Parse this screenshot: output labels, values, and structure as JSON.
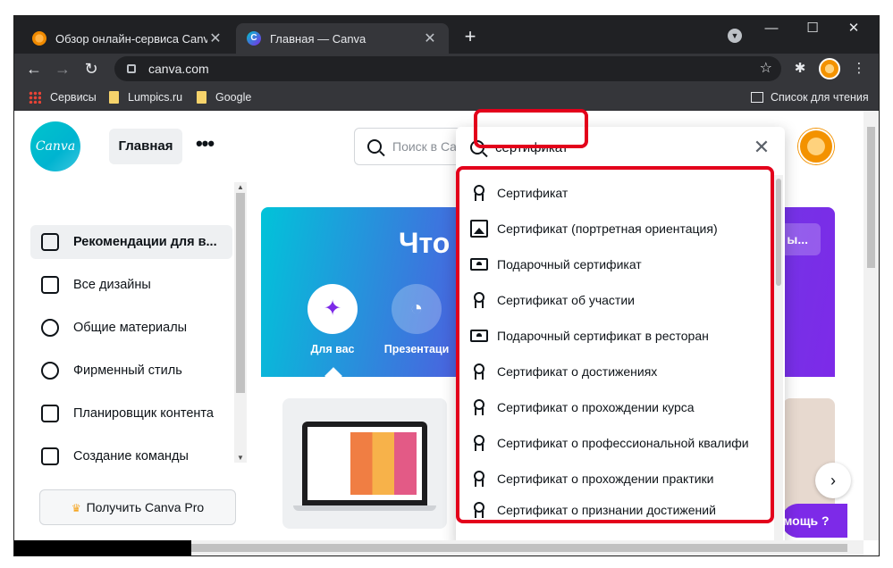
{
  "browser": {
    "tabs": [
      {
        "title": "Обзор онлайн-сервиса Canva",
        "favicon": "orange-icon"
      },
      {
        "title": "Главная — Canva",
        "favicon": "canva-icon"
      }
    ],
    "favicon_letter": "C",
    "url": "canva.com",
    "bookmarks": [
      {
        "label": "Сервисы"
      },
      {
        "label": "Lumpics.ru"
      },
      {
        "label": "Google"
      }
    ],
    "reading_list": "Список для чтения"
  },
  "canva": {
    "logo_text": "Canva",
    "home_button": "Главная",
    "search_placeholder": "Поиск в Ca",
    "sidebar": [
      {
        "label": "Рекомендации для в...",
        "icon": "home-icon"
      },
      {
        "label": "Все дизайны",
        "icon": "grid-icon"
      },
      {
        "label": "Общие материалы",
        "icon": "people-icon"
      },
      {
        "label": "Фирменный стиль",
        "icon": "brand-icon"
      },
      {
        "label": "Планировщик контента",
        "icon": "calendar-icon"
      },
      {
        "label": "Создание команды",
        "icon": "team-icon"
      }
    ],
    "pro_button": "Получить Canva Pro",
    "hero": {
      "title": "Что",
      "cta": "ы...",
      "categories": [
        {
          "label": "Для вас",
          "icon": "sparkle-icon"
        },
        {
          "label": "Презентаци",
          "icon": "presentation-icon"
        }
      ]
    },
    "help_button": "мощь ?",
    "colors": {
      "brand": "#00c4cc",
      "accent": "#7d2ae8",
      "highlight": "#e3001b"
    }
  },
  "search": {
    "query": "сертификат",
    "suggestions": [
      {
        "label": "Сертификат",
        "icon": "award-icon"
      },
      {
        "label": "Сертификат (портретная ориентация)",
        "icon": "image-icon"
      },
      {
        "label": "Подарочный сертификат",
        "icon": "gift-card-icon"
      },
      {
        "label": "Сертификат об участии",
        "icon": "award-icon"
      },
      {
        "label": "Подарочный сертификат в ресторан",
        "icon": "gift-card-icon"
      },
      {
        "label": "Сертификат о достижениях",
        "icon": "award-icon"
      },
      {
        "label": "Сертификат о прохождении курса",
        "icon": "award-icon"
      },
      {
        "label": "Сертификат о профессиональной квалифи",
        "icon": "award-icon"
      },
      {
        "label": "Сертификат о прохождении практики",
        "icon": "award-icon"
      },
      {
        "label": "Сертификат о признании достижений",
        "icon": "award-icon"
      }
    ]
  }
}
